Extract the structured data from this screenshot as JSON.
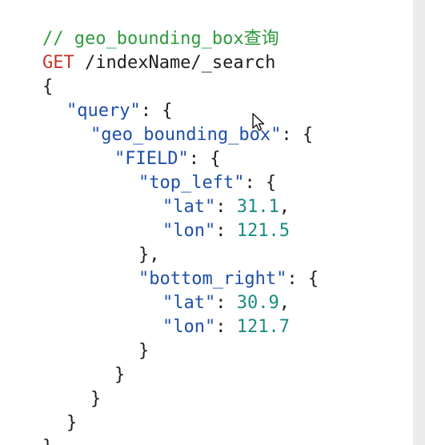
{
  "editor": {
    "comment": "// geo_bounding_box查询",
    "request": {
      "method": "GET",
      "path": " /indexName/_search"
    },
    "lines": {
      "l3_open": "{",
      "l4_key": "\"query\"",
      "l4_rest": ": {",
      "l5_key": "\"geo_bounding_box\"",
      "l5_rest": ": {",
      "l6_key": "\"FIELD\"",
      "l6_rest": ": {",
      "l7_key": "\"top_left\"",
      "l7_rest": ": {",
      "l8_key": "\"lat\"",
      "l8_sep": ": ",
      "l8_val": "31.1",
      "l8_end": ",",
      "l9_key": "\"lon\"",
      "l9_sep": ": ",
      "l9_val": "121.5",
      "l10": "},",
      "l11_key": "\"bottom_right\"",
      "l11_rest": ": {",
      "l12_key": "\"lat\"",
      "l12_sep": ": ",
      "l12_val": "30.9",
      "l12_end": ",",
      "l13_key": "\"lon\"",
      "l13_sep": ": ",
      "l13_val": "121.7",
      "l14": "}",
      "l15": "}",
      "l16": "}",
      "l17": "}",
      "l18": "}"
    }
  },
  "colors": {
    "comment": "#2e9b3e",
    "method": "#c0392b",
    "key": "#1f4fa8",
    "number": "#1a8c84",
    "text": "#1f1f1f"
  },
  "icons": {
    "cursor": "mouse-pointer-icon"
  }
}
